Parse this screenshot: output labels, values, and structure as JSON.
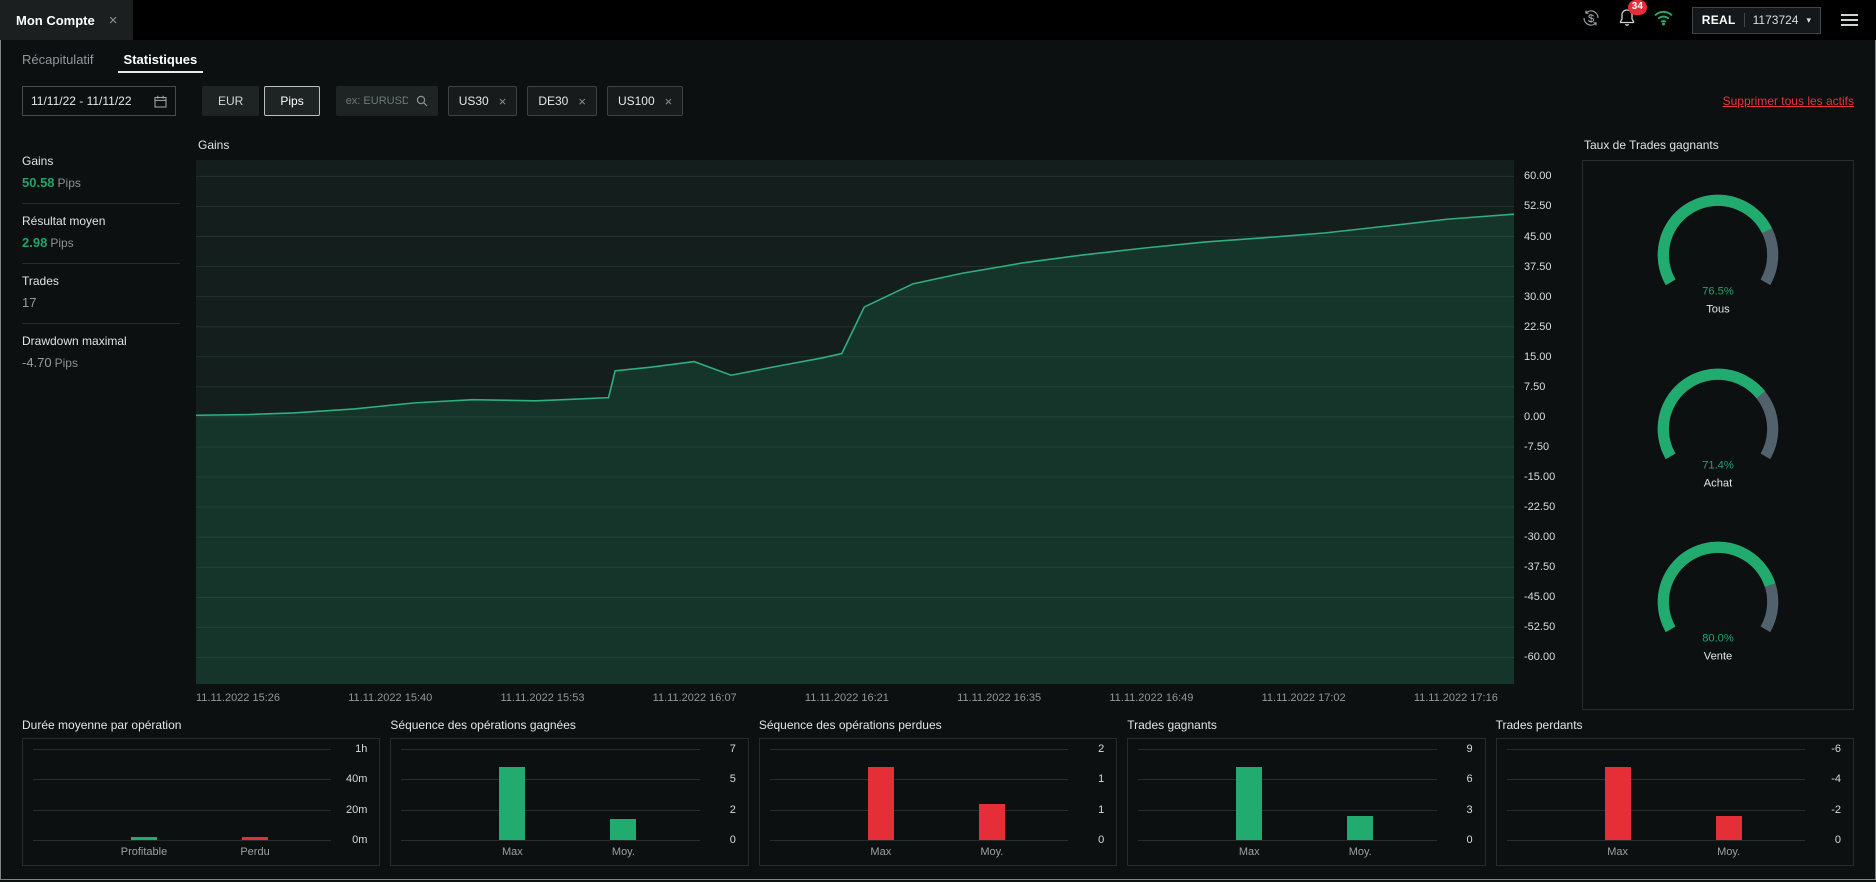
{
  "window_tab": {
    "label": "Mon Compte",
    "close_glyph": "×"
  },
  "topbar": {
    "notification_count": "34",
    "account_type": "REAL",
    "account_number": "1173724",
    "caret": "▾"
  },
  "nav_tabs": [
    {
      "label": "Récapitulatif",
      "active": false
    },
    {
      "label": "Statistiques",
      "active": true
    }
  ],
  "filters": {
    "date_range": "11/11/22 - 11/11/22",
    "currency": "EUR",
    "unit": "Pips",
    "search_placeholder": "ex: EURUSD",
    "assets": [
      "US30",
      "DE30",
      "US100"
    ],
    "chip_close": "×",
    "remove_all_label": "Supprimer tous les actifs"
  },
  "summary_stats": [
    {
      "label": "Gains",
      "value": "50.58",
      "unit": "Pips",
      "tone": "green"
    },
    {
      "label": "Résultat moyen",
      "value": "2.98",
      "unit": "Pips",
      "tone": "green"
    },
    {
      "label": "Trades",
      "value": "17",
      "unit": "",
      "tone": "muted"
    },
    {
      "label": "Drawdown maximal",
      "value": "-4.70",
      "unit": "Pips",
      "tone": "muted"
    }
  ],
  "colors": {
    "green": "#21ab6e",
    "red": "#e62e38",
    "gauge_track": "#51626c",
    "line_green": "#2fae7e"
  },
  "chart_data": [
    {
      "id": "gains",
      "type": "area",
      "title": "Gains",
      "ylim": [
        -60,
        60
      ],
      "ytick_labels": [
        "60.00",
        "52.50",
        "45.00",
        "37.50",
        "30.00",
        "22.50",
        "15.00",
        "7.50",
        "0.00",
        "-7.50",
        "-15.00",
        "-22.50",
        "-30.00",
        "-37.50",
        "-45.00",
        "-52.50",
        "-60.00"
      ],
      "x_tick_labels": [
        "11.11.2022 15:26",
        "11.11.2022 15:40",
        "11.11.2022 15:53",
        "11.11.2022 16:07",
        "11.11.2022 16:21",
        "11.11.2022 16:35",
        "11.11.2022 16:49",
        "11.11.2022 17:02",
        "11.11.2022 17:16"
      ],
      "points": [
        [
          0,
          0.4
        ],
        [
          0.04,
          0.6
        ],
        [
          0.074,
          1.0
        ],
        [
          0.12,
          2.0
        ],
        [
          0.166,
          3.5
        ],
        [
          0.21,
          4.3
        ],
        [
          0.24,
          4.1
        ],
        [
          0.258,
          4.0
        ],
        [
          0.285,
          4.4
        ],
        [
          0.313,
          4.8
        ],
        [
          0.318,
          11.5
        ],
        [
          0.345,
          12.4
        ],
        [
          0.359,
          13.0
        ],
        [
          0.378,
          13.8
        ],
        [
          0.406,
          10.4
        ],
        [
          0.442,
          12.7
        ],
        [
          0.475,
          14.7
        ],
        [
          0.49,
          15.8
        ],
        [
          0.507,
          27.4
        ],
        [
          0.544,
          33.2
        ],
        [
          0.581,
          35.8
        ],
        [
          0.627,
          38.4
        ],
        [
          0.673,
          40.4
        ],
        [
          0.719,
          42.1
        ],
        [
          0.765,
          43.6
        ],
        [
          0.811,
          44.7
        ],
        [
          0.857,
          45.9
        ],
        [
          0.903,
          47.6
        ],
        [
          0.949,
          49.3
        ],
        [
          1,
          50.58
        ]
      ],
      "line_color": "#2fae7e",
      "fill_color": "rgba(33,171,110,0.16)",
      "grid": true,
      "legend": "none"
    },
    {
      "id": "win_rate",
      "type": "gauge",
      "title": "Taux de Trades gagnants",
      "sweep_deg": 240,
      "value_color": "#21ab6e",
      "track_color": "#51626c",
      "gauges": [
        {
          "label": "Tous",
          "value": 76.5,
          "display": "76.5%"
        },
        {
          "label": "Achat",
          "value": 71.4,
          "display": "71.4%"
        },
        {
          "label": "Vente",
          "value": 80.0,
          "display": "80.0%"
        }
      ]
    },
    {
      "id": "avg_duration",
      "type": "bar",
      "title": "Durée moyenne par opération",
      "categories": [
        "Profitable",
        "Perdu"
      ],
      "values": [
        1,
        1
      ],
      "bar_colors": [
        "#21ab6e",
        "#e62e38"
      ],
      "ymax": 60,
      "ytick_labels": [
        "1h",
        "40m",
        "20m",
        "0m"
      ]
    },
    {
      "id": "win_streak",
      "type": "bar",
      "title": "Séquence des opérations gagnées",
      "categories": [
        "Max",
        "Moy."
      ],
      "values": [
        7,
        2
      ],
      "bar_colors": [
        "#21ab6e",
        "#21ab6e"
      ],
      "ymax": 7,
      "ytick_labels": [
        "7",
        "5",
        "2",
        "0"
      ]
    },
    {
      "id": "loss_streak",
      "type": "bar",
      "title": "Séquence des opérations perdues",
      "categories": [
        "Max",
        "Moy."
      ],
      "values": [
        2,
        1
      ],
      "bar_colors": [
        "#e62e38",
        "#e62e38"
      ],
      "ymax": 2,
      "ytick_labels": [
        "2",
        "1",
        "1",
        "0"
      ]
    },
    {
      "id": "winning_trades",
      "type": "bar",
      "title": "Trades gagnants",
      "categories": [
        "Max",
        "Moy."
      ],
      "values": [
        9,
        3
      ],
      "bar_colors": [
        "#21ab6e",
        "#21ab6e"
      ],
      "ymax": 9,
      "ytick_labels": [
        "9",
        "6",
        "3",
        "0"
      ]
    },
    {
      "id": "losing_trades",
      "type": "bar",
      "title": "Trades perdants",
      "categories": [
        "Max",
        "Moy."
      ],
      "values": [
        -6,
        -2
      ],
      "bar_colors": [
        "#e62e38",
        "#e62e38"
      ],
      "ymax": 6,
      "ytick_labels": [
        "-6",
        "-4",
        "-2",
        "0"
      ]
    }
  ]
}
